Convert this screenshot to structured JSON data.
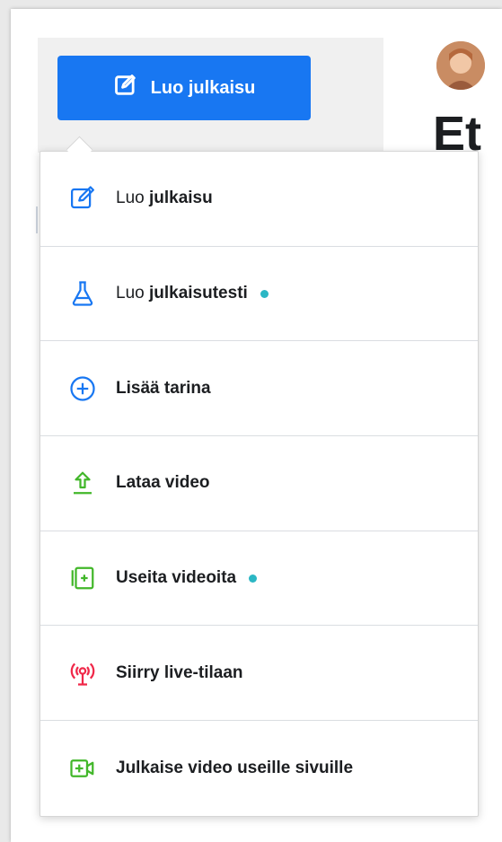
{
  "create_button": {
    "label": "Luo julkaisu",
    "icon": "edit-icon"
  },
  "heading_fragment": "Et",
  "menu": {
    "items": [
      {
        "name": "luo-julkaisu",
        "icon": "edit-icon",
        "light": "Luo",
        "bold": "julkaisu",
        "has_dot": false,
        "icon_color": "#1877f2"
      },
      {
        "name": "luo-julkaisutesti",
        "icon": "flask-icon",
        "light": "Luo",
        "bold": "julkaisutesti",
        "has_dot": true,
        "icon_color": "#1877f2"
      },
      {
        "name": "lisaa-tarina",
        "icon": "plus-circle-icon",
        "light": "",
        "bold": "Lisää tarina",
        "has_dot": false,
        "icon_color": "#1877f2"
      },
      {
        "name": "lataa-video",
        "icon": "upload-icon",
        "light": "",
        "bold": "Lataa video",
        "has_dot": false,
        "icon_color": "#42b72a"
      },
      {
        "name": "useita-videoita",
        "icon": "video-stack-icon",
        "light": "",
        "bold": "Useita videoita",
        "has_dot": true,
        "icon_color": "#42b72a"
      },
      {
        "name": "siirry-live-tilaan",
        "icon": "live-broadcast-icon",
        "light": "",
        "bold": "Siirry live-tilaan",
        "has_dot": false,
        "icon_color": "#f02849"
      },
      {
        "name": "julkaise-video-useille-sivuille",
        "icon": "video-add-icon",
        "light": "",
        "bold": "Julkaise video useille sivuille",
        "has_dot": false,
        "icon_color": "#42b72a"
      }
    ]
  },
  "colors": {
    "accent": "#1877f2",
    "dot": "#2bb7c4"
  }
}
